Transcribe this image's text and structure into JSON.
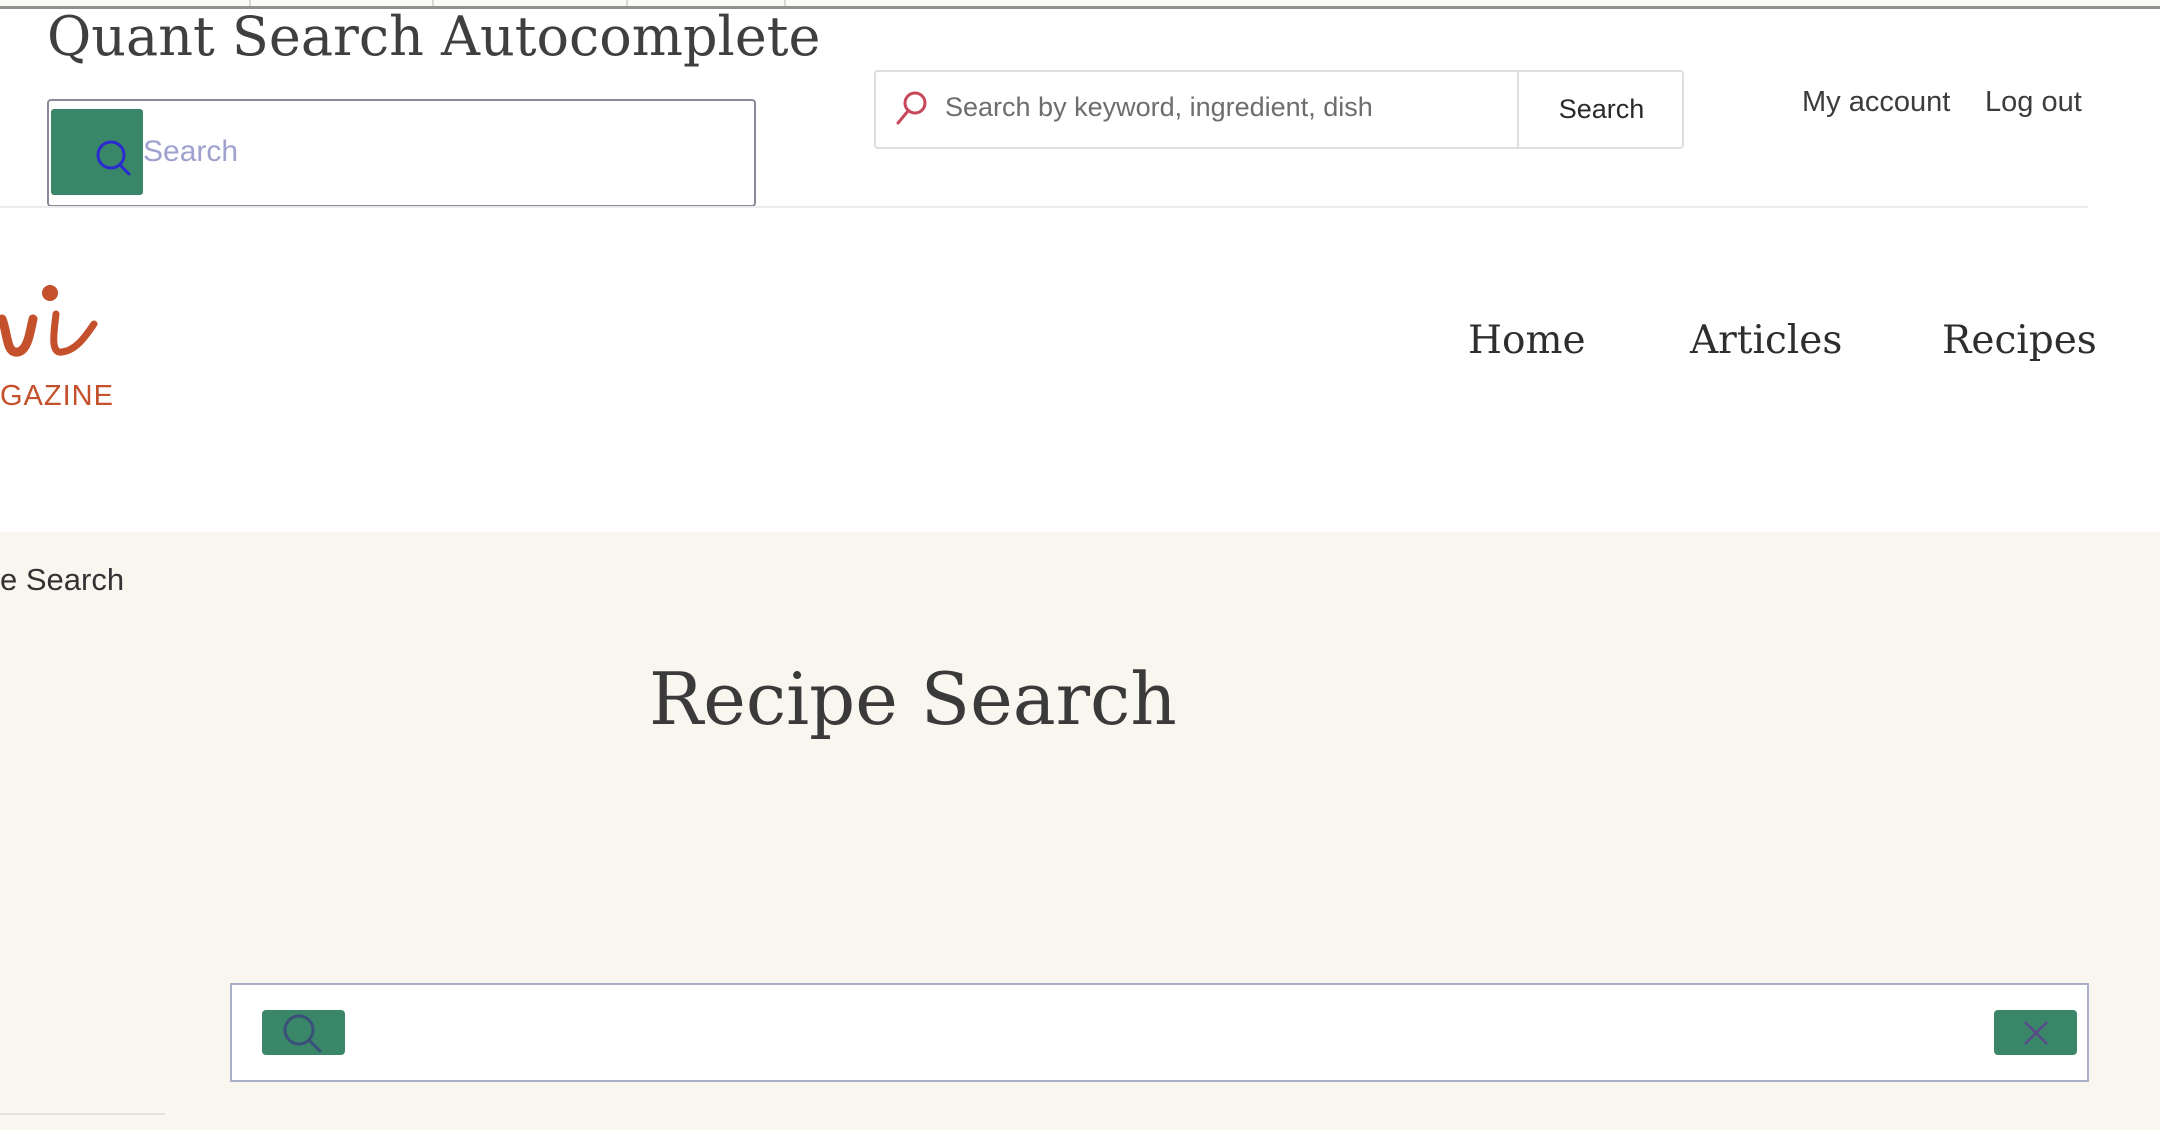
{
  "autocomplete_demo": {
    "title": "Quant Search Autocomplete",
    "search_placeholder": "Search"
  },
  "header": {
    "site_search": {
      "placeholder": "Search by keyword, ingredient, dish",
      "button_label": "Search"
    },
    "account_links": [
      "My account",
      "Log out"
    ],
    "logo_text": "GAZINE"
  },
  "nav": {
    "items": [
      "Home",
      "Articles",
      "Recipes"
    ]
  },
  "page": {
    "breadcrumb": "e Search",
    "title": "Recipe Search",
    "recipe_search_value": ""
  },
  "colors": {
    "accent_green": "#3a8668",
    "logo_orange": "#c4502c",
    "page_background": "#f9f5ef",
    "search_icon_red": "#c9475a"
  },
  "icons": {
    "autocomplete_search": "search-icon",
    "site_search": "search-icon",
    "recipe_search": "search-icon",
    "recipe_clear": "close-icon"
  }
}
